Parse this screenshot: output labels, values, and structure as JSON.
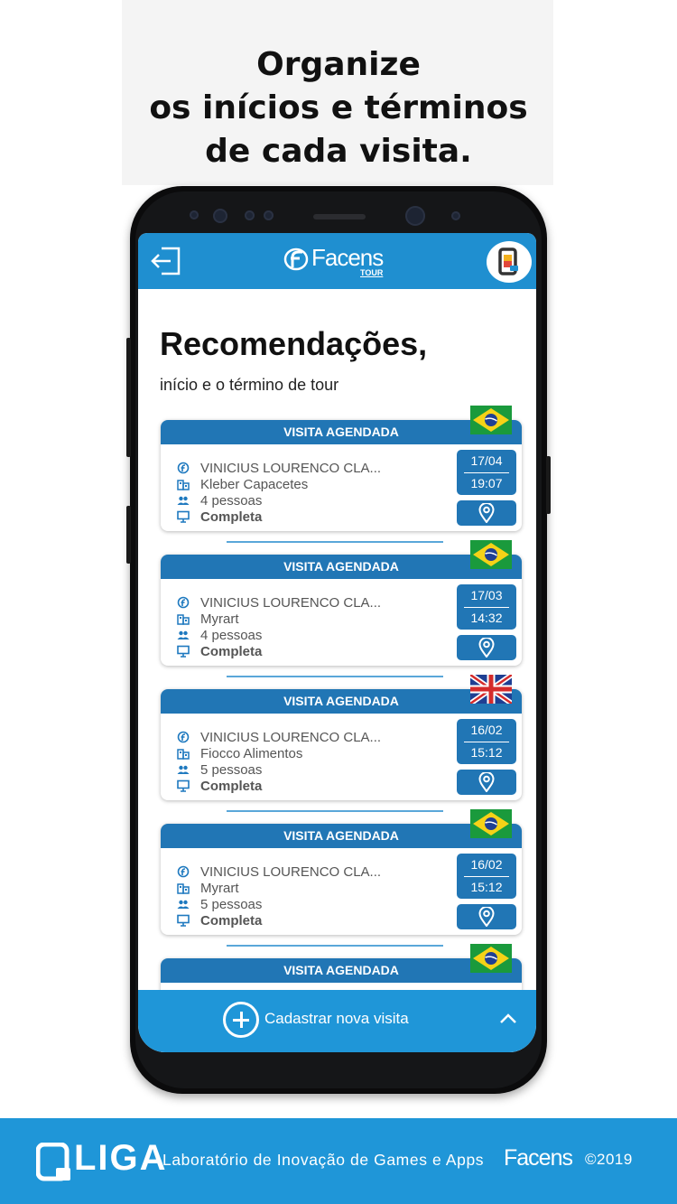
{
  "headline": [
    "Organize",
    "os inícios e términos",
    "de cada visita."
  ],
  "app": {
    "brand": "Facens",
    "brand_sub": "TOUR",
    "title": "Recomendações,",
    "subtitle": "início e o término de tour"
  },
  "visits": [
    {
      "status": "VISITA AGENDADA",
      "flag": "brazil",
      "student": "VINICIUS LOURENCO CLA...",
      "company": "Kleber Capacetes",
      "people": "4 pessoas",
      "state": "Completa",
      "date": "17/04",
      "time": "19:07"
    },
    {
      "status": "VISITA AGENDADA",
      "flag": "brazil",
      "student": "VINICIUS LOURENCO CLA...",
      "company": "Myrart",
      "people": "4 pessoas",
      "state": "Completa",
      "date": "17/03",
      "time": "14:32"
    },
    {
      "status": "VISITA AGENDADA",
      "flag": "uk",
      "student": "VINICIUS LOURENCO CLA...",
      "company": "Fiocco Alimentos",
      "people": "5 pessoas",
      "state": "Completa",
      "date": "16/02",
      "time": "15:12"
    },
    {
      "status": "VISITA AGENDADA",
      "flag": "brazil",
      "student": "VINICIUS LOURENCO CLA...",
      "company": "Myrart",
      "people": "5 pessoas",
      "state": "Completa",
      "date": "16/02",
      "time": "15:12"
    },
    {
      "status": "VISITA AGENDADA",
      "flag": "brazil"
    }
  ],
  "bottom_bar": {
    "label": "Cadastrar nova visita"
  },
  "footer": {
    "liga": "LIGA",
    "lab": "Laboratório de Inovação de Games e Apps",
    "brand": "Facens",
    "copyright": "©2019"
  },
  "colors": {
    "primary": "#1f8fd0",
    "card_header": "#2176b5",
    "footer": "#1f96d8"
  },
  "icons": [
    "exit-icon",
    "facens-logo-icon",
    "app-badge-icon",
    "user-icon",
    "company-icon",
    "people-icon",
    "status-icon",
    "map-pin-icon",
    "plus-icon",
    "chevron-up-icon",
    "brazil-flag",
    "uk-flag"
  ]
}
